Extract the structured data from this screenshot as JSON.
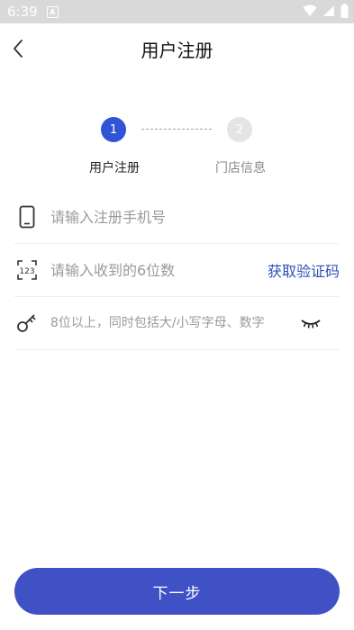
{
  "status_bar": {
    "time": "6:39",
    "notification_glyph": "A"
  },
  "header": {
    "title": "用户注册"
  },
  "stepper": {
    "steps": [
      {
        "number": "1",
        "label": "用户注册",
        "active": true
      },
      {
        "number": "2",
        "label": "门店信息",
        "active": false
      }
    ]
  },
  "form": {
    "phone": {
      "icon": "phone-icon",
      "placeholder": "请输入注册手机号",
      "value": ""
    },
    "code": {
      "icon": "number-code-icon",
      "placeholder": "请输入收到的6位数",
      "value": "",
      "action_label": "获取验证码"
    },
    "password": {
      "icon": "key-icon",
      "placeholder": "8位以上，同时包括大/小写字母、数字",
      "value": "",
      "toggle_icon": "eye-closed-icon"
    }
  },
  "footer": {
    "next_label": "下一步"
  },
  "colors": {
    "primary": "#3f51c5",
    "step_active": "#2f54d6",
    "step_inactive": "#e4e4e4",
    "link": "#2f4fb8",
    "status_bar": "#d9d9d9"
  }
}
